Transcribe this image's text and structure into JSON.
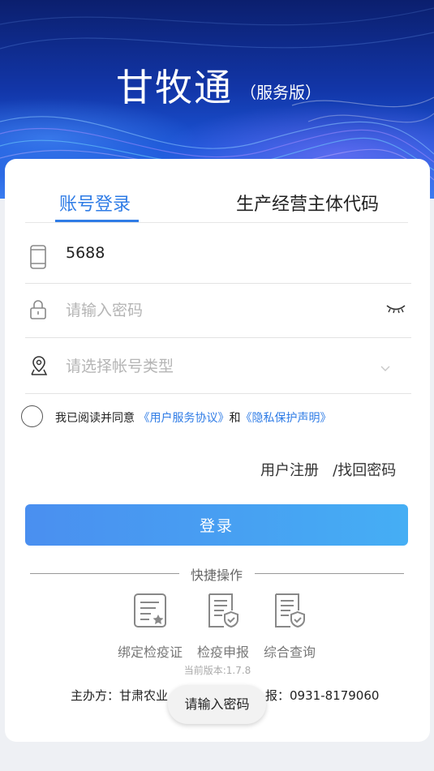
{
  "header": {
    "title": "甘牧通",
    "subtitle": "（服务版）"
  },
  "tabs": {
    "account_login": "账号登录",
    "entity_code": "生产经营主体代码"
  },
  "form": {
    "phone_value": "5688",
    "password_placeholder": "请输入密码",
    "account_type_placeholder": "请选择帐号类型"
  },
  "agreement": {
    "prefix": "我已阅读并同意",
    "user_agreement": "《用户服务协议》",
    "and": "和",
    "privacy": "《隐私保护声明》"
  },
  "links": {
    "register": "用户注册",
    "recover": "/找回密码"
  },
  "login_button": "登录",
  "quick": {
    "label": "快捷操作",
    "items": [
      {
        "label": "绑定检疫证",
        "icon": "certificate-star-icon"
      },
      {
        "label": "检疫申报",
        "icon": "document-shield-icon"
      },
      {
        "label": "综合查询",
        "icon": "document-shield-query-icon"
      }
    ]
  },
  "version": "当前版本:1.7.8",
  "footer": "主办方：甘肃农业...报：0931-8179060",
  "footer_left": "主办方：甘肃农业",
  "footer_right": "报：0931-8179060",
  "toast": "请输入密码",
  "colors": {
    "accent": "#2f7ce6",
    "banner": "#1236a8"
  }
}
